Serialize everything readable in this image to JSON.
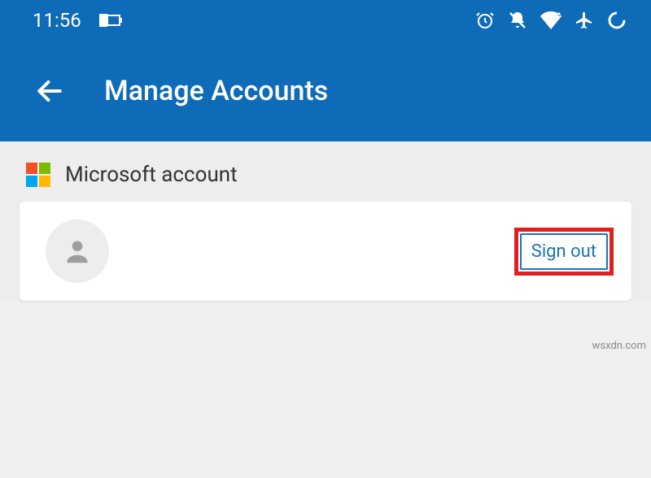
{
  "statusbar": {
    "time": "11:56"
  },
  "appbar": {
    "title": "Manage Accounts"
  },
  "section": {
    "title": "Microsoft account"
  },
  "account": {
    "signout_label": "Sign out"
  },
  "watermark": "wsxdn.com"
}
